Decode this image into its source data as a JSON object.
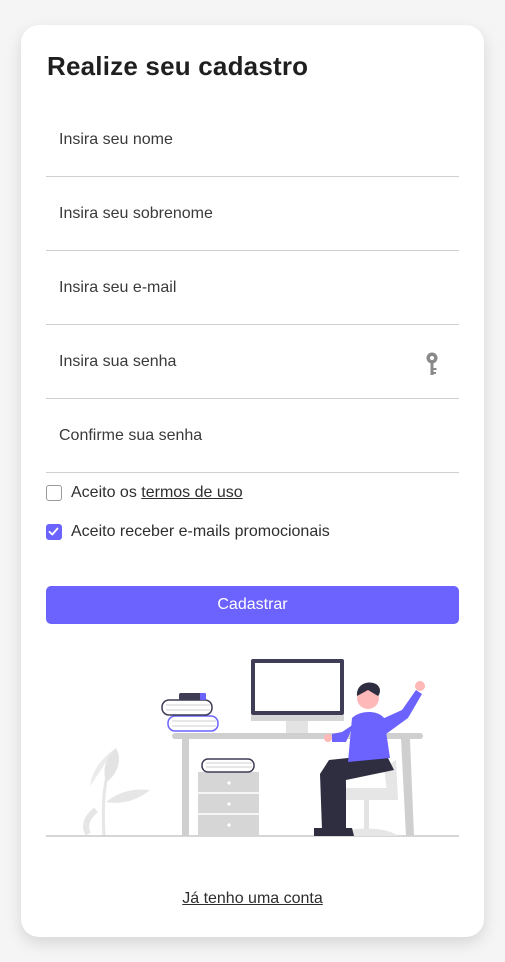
{
  "form": {
    "title": "Realize seu cadastro",
    "fields": [
      {
        "placeholder": "Insira seu nome",
        "value": ""
      },
      {
        "placeholder": "Insira seu sobrenome",
        "value": ""
      },
      {
        "placeholder": "Insira seu e-mail",
        "value": ""
      },
      {
        "placeholder": "Insira sua senha",
        "value": ""
      },
      {
        "placeholder": "Confirme sua senha",
        "value": ""
      }
    ],
    "password_toggle_icon": "key-icon",
    "terms": {
      "prefix": "Aceito os ",
      "link": "termos de uso",
      "checked": false
    },
    "promo": {
      "label": "Aceito receber e-mails promocionais",
      "checked": true
    },
    "submit_label": "Cadastrar",
    "login_link": "Já tenho uma conta"
  },
  "colors": {
    "accent": "#6c63ff",
    "background": "#f5f5f5",
    "card": "#ffffff"
  }
}
